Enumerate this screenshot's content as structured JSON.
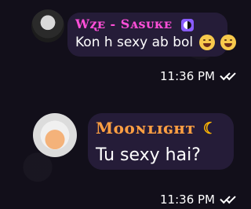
{
  "messages": [
    {
      "sender_name": "Wʐᴇ - Sᴀsᴜᴋᴇ",
      "message_text": "Kon h sexy ab bol",
      "time": "11:36 PM",
      "emoji_icons": [
        "laughing-tears-icon",
        "laughing-tears-icon"
      ],
      "badge_icon": "yin-yang-icon",
      "name_color": "#ff4fd8"
    },
    {
      "sender_name": "Mᴏᴏɴʟɪɢʜᴛ",
      "message_text": "Tu sexy hai?",
      "time": "11:36 PM",
      "badge_icon": "crescent-moon-icon",
      "name_color": "#ff9f42"
    }
  ],
  "colors": {
    "background": "#120f1a",
    "bubble": "#251c38",
    "text": "#ffffff"
  }
}
